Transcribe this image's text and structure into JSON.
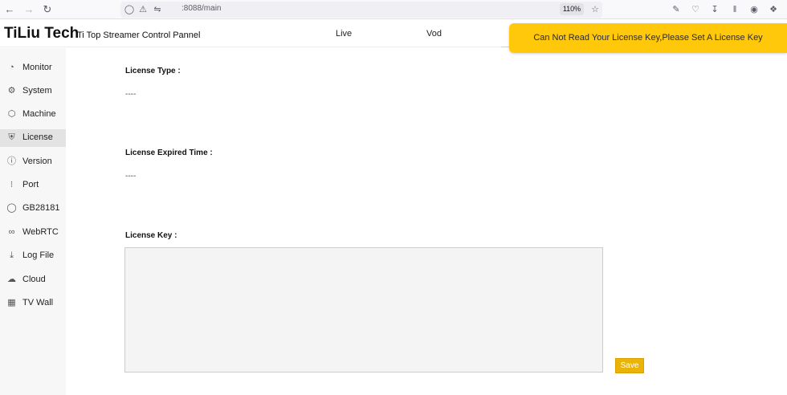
{
  "browser": {
    "url": " :8088/main",
    "zoom": "110%"
  },
  "header": {
    "brand": "TiLiu Tech",
    "subtitle": "Ti Top Streamer Control Pannel",
    "nav": [
      "Live",
      "Vod"
    ],
    "alert": "Can Not Read Your License Key,Please Set A License Key",
    "alert_color": "#ffc80a"
  },
  "sidebar": {
    "active": "License",
    "items": [
      {
        "label": "Monitor",
        "icon": "gauge-icon"
      },
      {
        "label": "System",
        "icon": "gear-icon"
      },
      {
        "label": "Machine",
        "icon": "cube-icon"
      },
      {
        "label": "License",
        "icon": "shield-icon"
      },
      {
        "label": "Version",
        "icon": "info-icon"
      },
      {
        "label": "Port",
        "icon": "network-icon"
      },
      {
        "label": "GB28181",
        "icon": "badge-icon"
      },
      {
        "label": "WebRTC",
        "icon": "link-icon"
      },
      {
        "label": "Log File",
        "icon": "download-icon"
      },
      {
        "label": "Cloud",
        "icon": "cloud-icon"
      },
      {
        "label": "TV Wall",
        "icon": "grid-icon"
      }
    ]
  },
  "main": {
    "license_type_label": "License Type :",
    "license_type_value": "----",
    "expired_label": "License Expired Time :",
    "expired_value": "----",
    "key_label": "License Key :",
    "key_value": "",
    "save_label": "Save",
    "save_color": "#eab308"
  }
}
